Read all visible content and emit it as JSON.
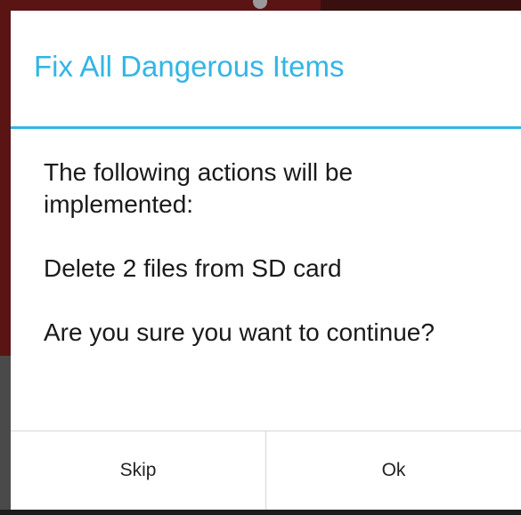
{
  "dialog": {
    "title": "Fix All Dangerous Items",
    "message": {
      "line1": "The following actions will be implemented:",
      "line2": "Delete 2 files from SD card",
      "line3": "Are you sure you want to continue?"
    },
    "buttons": {
      "negative_label": "Skip",
      "positive_label": "Ok"
    }
  },
  "colors": {
    "accent": "#33b5e5",
    "background_dim": "#5a1414"
  }
}
